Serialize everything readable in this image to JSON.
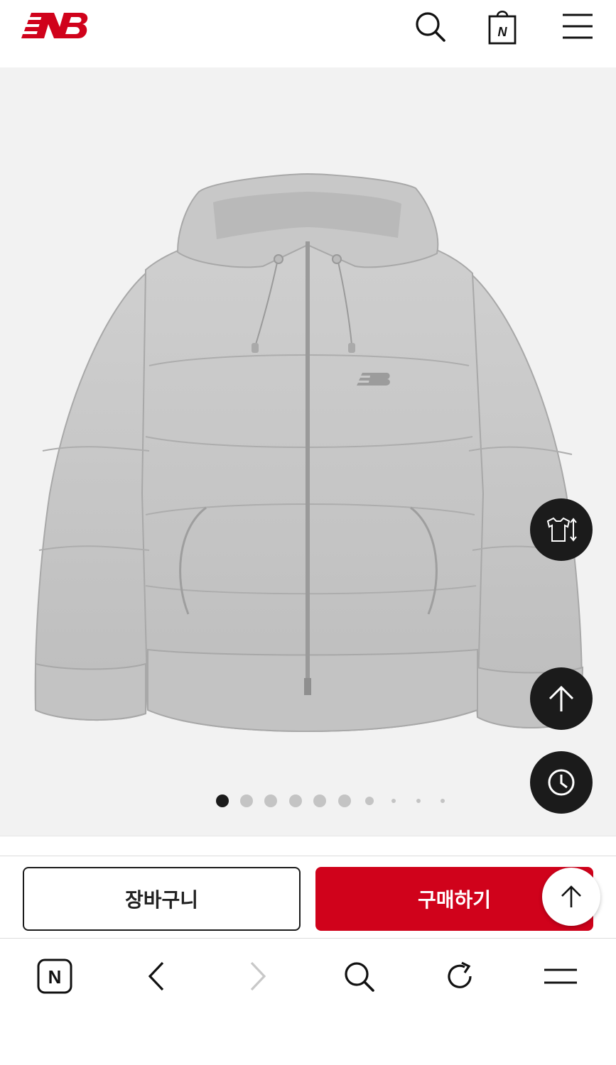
{
  "header": {
    "logo_icon": "new-balance-logo-icon",
    "search_icon": "search-icon",
    "bag_icon": "shopping-bag-icon",
    "bag_letter": "N",
    "menu_icon": "hamburger-menu-icon",
    "brand_color": "#d0021b"
  },
  "gallery": {
    "image_description_icon": "gray-hooded-puffer-jacket-image",
    "total_slides": 10,
    "active_slide": 1,
    "floating_buttons": [
      {
        "name": "size-guide-icon"
      },
      {
        "name": "arrow-up-icon"
      },
      {
        "name": "clock-history-icon"
      }
    ]
  },
  "actions": {
    "cart_label": "장바구니",
    "buy_label": "구매하기",
    "buy_color": "#d0021b"
  },
  "browser": {
    "home_letter": "N",
    "icons": [
      "naver-home-icon",
      "back-chevron-icon",
      "forward-chevron-icon",
      "search-icon",
      "refresh-icon",
      "menu-icon"
    ]
  }
}
